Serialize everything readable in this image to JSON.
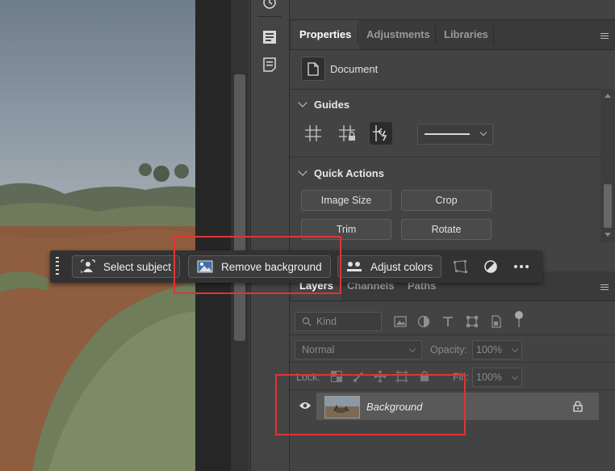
{
  "properties_panel": {
    "tabs": [
      {
        "label": "Properties",
        "active": true
      },
      {
        "label": "Adjustments",
        "active": false
      },
      {
        "label": "Libraries",
        "active": false
      }
    ],
    "document_label": "Document",
    "guides_title": "Guides",
    "quick_actions_title": "Quick Actions",
    "quick_actions": [
      "Image Size",
      "Crop",
      "Trim",
      "Rotate"
    ]
  },
  "contextual_taskbar": {
    "select_subject_label": "Select subject",
    "remove_background_label": "Remove background",
    "adjust_colors_label": "Adjust colors"
  },
  "layers_panel": {
    "tabs": [
      {
        "label": "Layers",
        "active": true
      },
      {
        "label": "Channels",
        "active": false
      },
      {
        "label": "Paths",
        "active": false
      }
    ],
    "filter_kind": "Kind",
    "blend_mode": "Normal",
    "opacity_label": "Opacity:",
    "opacity_value": "100%",
    "lock_label": "Lock:",
    "fill_label": "Fill:",
    "fill_value": "100%",
    "layers": [
      {
        "name": "Background",
        "visible": true,
        "locked": true
      }
    ]
  },
  "colors": {
    "highlight": "#e03434",
    "panel_bg": "#434343",
    "active_tab_text": "#ffffff"
  }
}
